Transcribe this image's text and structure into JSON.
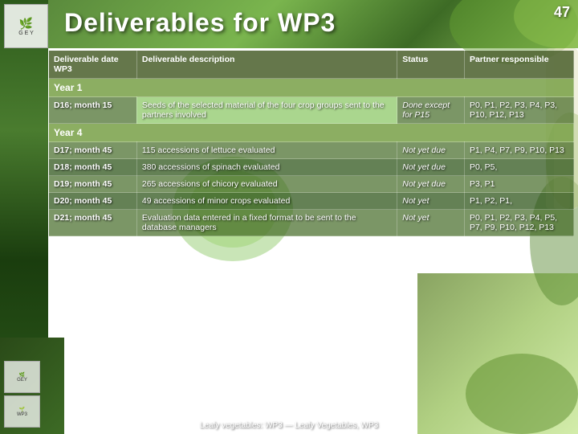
{
  "page": {
    "number": "47",
    "title": "Deliverables for WP3",
    "bottom_label": "Leafy vegetables: WP3 — Leafy Vegetables, WP3"
  },
  "logo": {
    "text": "G E Y"
  },
  "table": {
    "headers": {
      "col1": "Deliverable date WP3",
      "col2": "Deliverable description",
      "col3": "Status",
      "col4": "Partner responsible"
    },
    "sections": [
      {
        "year_label": "Year 1",
        "rows": [
          {
            "deliverable": "D16; month 15",
            "description": "Seeds of the selected material of the four crop groups sent to the partners involved",
            "status": "Done except for P15",
            "partner": "P0, P1, P2, P3, P4, P3, P10, P12, P13"
          }
        ]
      },
      {
        "year_label": "Year 4",
        "rows": [
          {
            "deliverable": "D17; month 45",
            "description": "115 accessions of lettuce evaluated",
            "status": "Not yet due",
            "partner": "P1, P4, P7, P9, P10, P13"
          },
          {
            "deliverable": "D18; month 45",
            "description": "380 accessions of spinach evaluated",
            "status": "Not yet due",
            "partner": "P0, P5,"
          },
          {
            "deliverable": "D19; month 45",
            "description": "265 accessions of chicory evaluated",
            "status": "Not yet due",
            "partner": "P3, P1"
          },
          {
            "deliverable": "D20; month 45",
            "description": "49 accessions of minor crops evaluated",
            "status": "Not yet",
            "partner": "P1, P2, P1,"
          },
          {
            "deliverable": "D21; month 45",
            "description": "Evaluation data entered in a fixed format to be sent to the database managers",
            "status": "Not yet",
            "partner": "P0, P1, P2, P3, P4, P5, P7, P9, P10, P12, P13"
          }
        ]
      }
    ]
  }
}
